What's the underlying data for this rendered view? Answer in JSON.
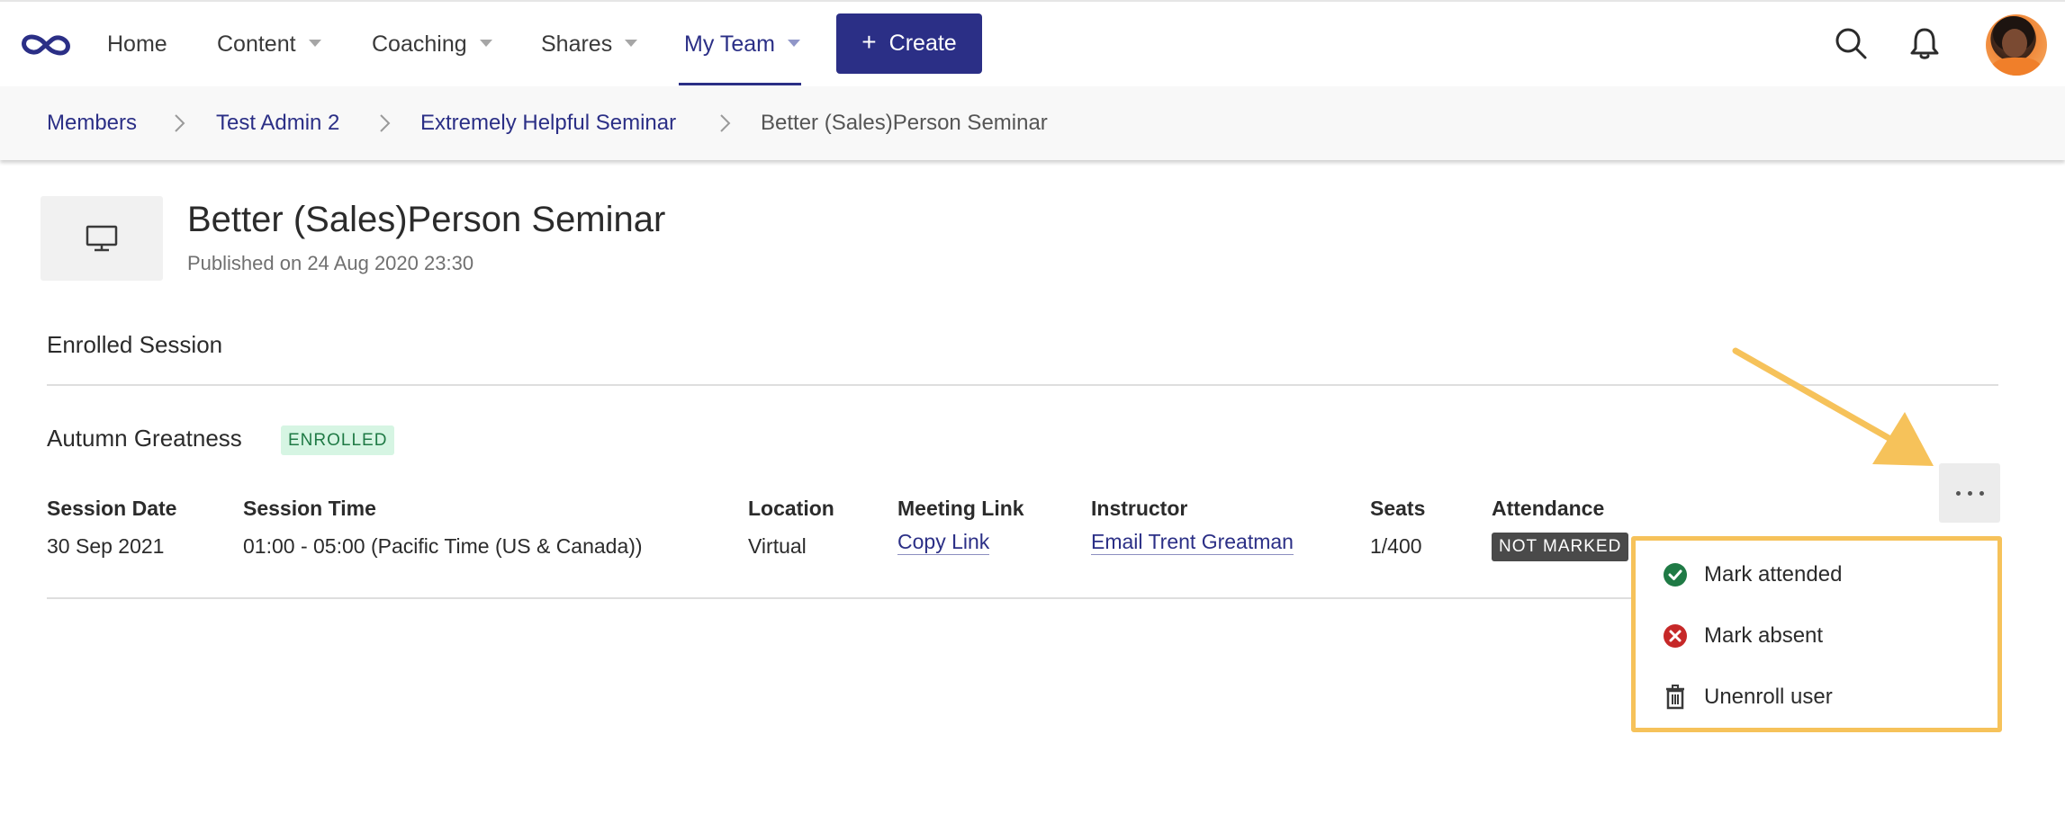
{
  "nav": {
    "items": [
      {
        "label": "Home",
        "has_caret": false
      },
      {
        "label": "Content",
        "has_caret": true
      },
      {
        "label": "Coaching",
        "has_caret": true
      },
      {
        "label": "Shares",
        "has_caret": true
      },
      {
        "label": "My Team",
        "has_caret": true,
        "active": true
      }
    ],
    "create_label": "Create",
    "accent_color": "#2b2f86"
  },
  "breadcrumb": {
    "items": [
      "Members",
      "Test Admin 2",
      "Extremely Helpful Seminar",
      "Better (Sales)Person Seminar"
    ]
  },
  "content": {
    "title": "Better (Sales)Person Seminar",
    "published": "Published on 24 Aug 2020 23:30",
    "section_title": "Enrolled Session"
  },
  "session": {
    "name": "Autumn Greatness",
    "status_badge": "ENROLLED",
    "columns": {
      "date": {
        "header": "Session Date",
        "value": "30 Sep 2021"
      },
      "time": {
        "header": "Session Time",
        "value": "01:00 - 05:00 (Pacific Time (US & Canada))"
      },
      "location": {
        "header": "Location",
        "value": "Virtual"
      },
      "meeting": {
        "header": "Meeting Link",
        "value": "Copy Link"
      },
      "instructor": {
        "header": "Instructor",
        "value": "Email Trent Greatman"
      },
      "seats": {
        "header": "Seats",
        "value": "1/400"
      },
      "attendance": {
        "header": "Attendance",
        "value": "NOT MARKED"
      }
    }
  },
  "menu": {
    "items": [
      {
        "label": "Mark attended",
        "icon": "check-circle-icon"
      },
      {
        "label": "Mark absent",
        "icon": "x-circle-icon"
      },
      {
        "label": "Unenroll user",
        "icon": "trash-icon"
      }
    ],
    "highlight_color": "#f6c25a"
  }
}
